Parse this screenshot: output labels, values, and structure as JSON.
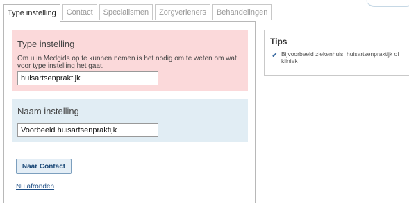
{
  "tabs": [
    {
      "label": "Type instelling",
      "active": true
    },
    {
      "label": "Contact",
      "active": false
    },
    {
      "label": "Specialismen",
      "active": false
    },
    {
      "label": "Zorgverleners",
      "active": false
    },
    {
      "label": "Behandelingen",
      "active": false
    }
  ],
  "type_section": {
    "title": "Type instelling",
    "help": "Om u in Medgids op te kunnen nemen is het nodig om te weten om wat voor type instelling het gaat.",
    "value": "huisartsenpraktijk"
  },
  "name_section": {
    "title": "Naam instelling",
    "value": "Voorbeeld huisartsenpraktijk"
  },
  "actions": {
    "next_button": "Naar Contact",
    "finish_link": "Nu afronden"
  },
  "tips": {
    "title": "Tips",
    "items": [
      {
        "icon": "checkmark-icon",
        "text": "Bijvoorbeeld ziekenhuis, huisartsenpraktijk of kliniek"
      }
    ]
  },
  "colors": {
    "pink_box": "#fbd9da",
    "blue_box": "#e1edf4",
    "button_text": "#1e4b79",
    "link": "#1f4f86"
  }
}
